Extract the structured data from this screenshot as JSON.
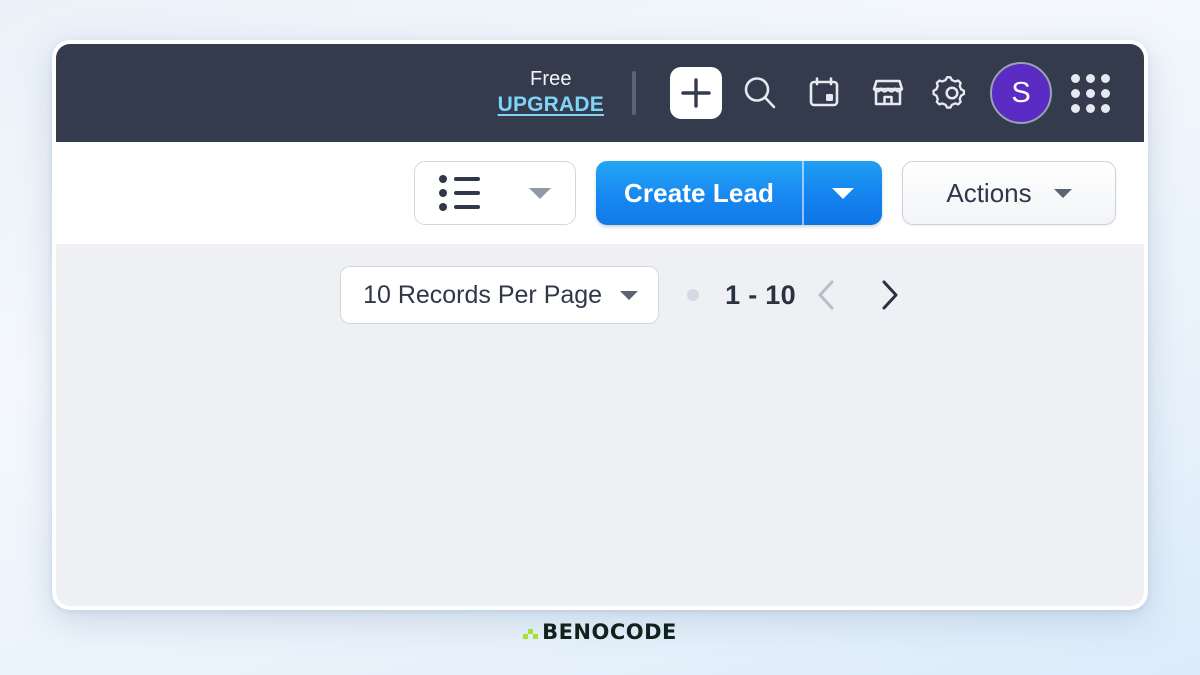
{
  "topbar": {
    "plan_label": "Free",
    "upgrade_label": "UPGRADE",
    "icons": {
      "add": "plus-icon",
      "search": "search-icon",
      "calendar": "calendar-icon",
      "marketplace": "store-icon",
      "settings": "gear-icon",
      "apps": "app-grid-icon"
    },
    "avatar_initial": "S",
    "avatar_color": "#5b2cc4",
    "background_color": "#343b4d",
    "upgrade_color": "#7ed3f7"
  },
  "toolbar": {
    "view_selector_icon": "list-view-icon",
    "create_label": "Create Lead",
    "create_color": "#1887f0",
    "actions_label": "Actions"
  },
  "content": {
    "records_per_page": "10 Records Per Page",
    "page_range": "1 - 10",
    "prev_enabled": false,
    "next_enabled": true,
    "background_color": "#eef0f3"
  },
  "footer": {
    "logo_text": "BENOCODE",
    "logo_accent_color": "#a6e22e"
  }
}
